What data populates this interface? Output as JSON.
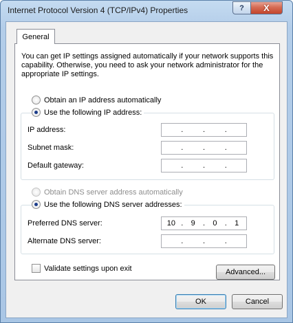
{
  "window": {
    "title": "Internet Protocol Version 4 (TCP/IPv4) Properties",
    "help_label": "?",
    "close_label": "X"
  },
  "tabs": [
    {
      "label": "General",
      "selected": true
    }
  ],
  "intro_text": "You can get IP settings assigned automatically if your network supports this capability. Otherwise, you need to ask your network administrator for the appropriate IP settings.",
  "ip": {
    "auto_label": "Obtain an IP address automatically",
    "manual_label": "Use the following IP address:",
    "selected": "manual",
    "fields": {
      "ip_address": {
        "label": "IP address:",
        "octets": [
          "",
          "",
          "",
          ""
        ]
      },
      "subnet_mask": {
        "label": "Subnet mask:",
        "octets": [
          "",
          "",
          "",
          ""
        ]
      },
      "default_gateway": {
        "label": "Default gateway:",
        "octets": [
          "",
          "",
          "",
          ""
        ]
      }
    }
  },
  "dns": {
    "auto_label": "Obtain DNS server address automatically",
    "auto_disabled": true,
    "manual_label": "Use the following DNS server addresses:",
    "selected": "manual",
    "fields": {
      "preferred": {
        "label": "Preferred DNS server:",
        "octets": [
          "10",
          "9",
          "0",
          "1"
        ]
      },
      "alternate": {
        "label": "Alternate DNS server:",
        "octets": [
          "",
          "",
          "",
          ""
        ]
      }
    }
  },
  "validate": {
    "label": "Validate settings upon exit",
    "checked": false
  },
  "buttons": {
    "advanced": "Advanced...",
    "ok": "OK",
    "cancel": "Cancel"
  },
  "ip_separator": "."
}
